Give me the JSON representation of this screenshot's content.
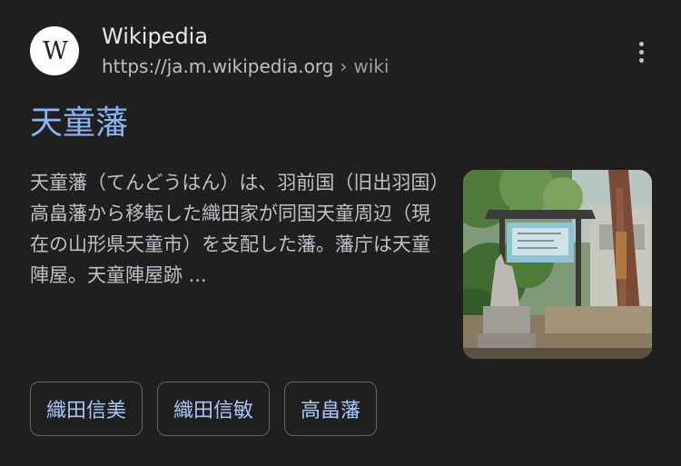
{
  "source": {
    "favicon_letter": "W",
    "site_name": "Wikipedia",
    "url_host": "https://ja.m.wikipedia.org",
    "url_separator": "›",
    "url_path": "wiki",
    "more_icon": "more-vert-icon"
  },
  "result": {
    "title": "天童藩",
    "snippet": "天童藩（てんどうはん）は、羽前国（旧出羽国）高畠藩から移転した織田家が同国天童周辺（現在の山形県天童市）を支配した藩。藩庁は天童陣屋。天童陣屋跡 ..."
  },
  "chips": [
    {
      "label": "織田信美"
    },
    {
      "label": "織田信敏"
    },
    {
      "label": "高畠藩"
    }
  ],
  "colors": {
    "background": "#1f1f1f",
    "title_link": "#8ab4f8",
    "chip_text": "#a8c7fa",
    "chip_border": "#5f6368",
    "snippet_text": "#bdc1c6"
  }
}
